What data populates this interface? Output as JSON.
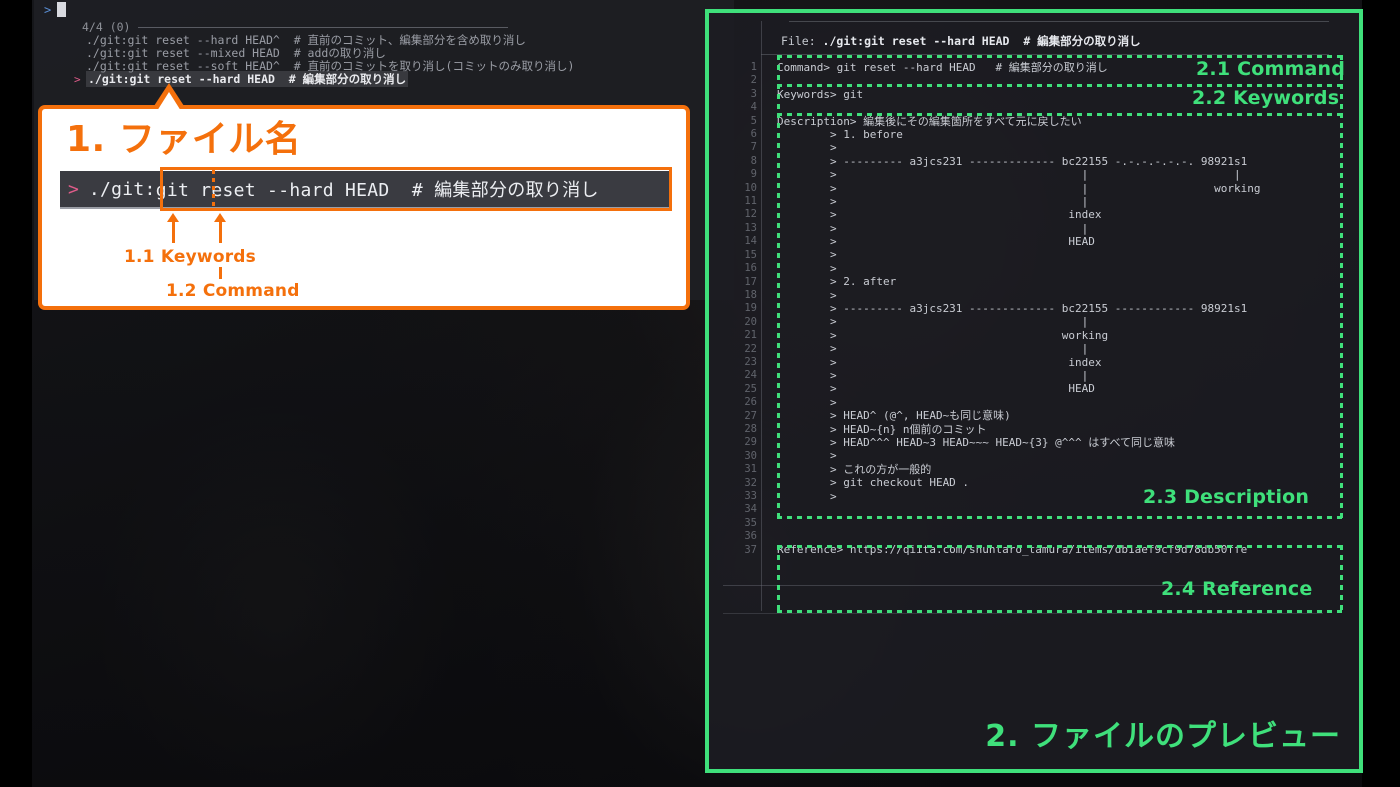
{
  "terminal": {
    "prompt_symbol": ">",
    "counter": "4/4 (0)",
    "items": [
      {
        "marker": "",
        "text": "./git:git reset --hard HEAD^  # 直前のコミット、編集部分を含め取り消し",
        "selected": false
      },
      {
        "marker": "",
        "text": "./git:git reset --mixed HEAD  # addの取り消し",
        "selected": false
      },
      {
        "marker": "",
        "text": "./git:git reset --soft HEAD^  # 直前のコミットを取り消し(コミットのみ取り消し)",
        "selected": false
      },
      {
        "marker": ">",
        "text": "./git:git reset --hard HEAD  # 編集部分の取り消し",
        "selected": true
      }
    ]
  },
  "callout1": {
    "title": "1. ファイル名",
    "prompt": ">",
    "path_prefix": "./",
    "keywords": "git",
    "separator": ":",
    "command": "git reset --hard HEAD  # 編集部分の取り消し",
    "label_keywords": "1.1 Keywords",
    "label_command": "1.2 Command",
    "accent_color": "#F4700C"
  },
  "preview": {
    "title": "2. ファイルのプレビュー",
    "accent_color": "#3FE07B",
    "file_label": "File: ",
    "file_name": "./git:git reset --hard HEAD  # 編集部分の取り消し",
    "line_numbers": [
      1,
      2,
      3,
      4,
      5,
      6,
      7,
      8,
      9,
      10,
      11,
      12,
      13,
      14,
      15,
      16,
      17,
      18,
      19,
      20,
      21,
      22,
      23,
      24,
      25,
      26,
      27,
      28,
      29,
      30,
      31,
      32,
      33,
      34,
      35,
      36,
      37
    ],
    "sections": [
      {
        "id": "command",
        "label": "2.1 Command"
      },
      {
        "id": "keywords",
        "label": "2.2 Keywords"
      },
      {
        "id": "description",
        "label": "2.3 Description"
      },
      {
        "id": "reference",
        "label": "2.4 Reference"
      }
    ],
    "lines": [
      "Command> git reset --hard HEAD   # 編集部分の取り消し",
      "",
      "Keywords> git",
      "",
      "Description> 編集後にその編集箇所をすべて元に戻したい",
      "        > 1. before",
      "        >",
      "        > --------- a3jcs231 ------------- bc22155 -.-.-.-.-.-. 98921s1",
      "        >                                     |                      |",
      "        >                                     |                   working",
      "        >                                     |",
      "        >                                   index",
      "        >                                     |",
      "        >                                   HEAD",
      "        >",
      "        >",
      "        > 2. after",
      "        >",
      "        > --------- a3jcs231 ------------- bc22155 ------------ 98921s1",
      "        >                                     |",
      "        >                                  working",
      "        >                                     |",
      "        >                                   index",
      "        >                                     |",
      "        >                                   HEAD",
      "        >",
      "        > HEAD^ (@^, HEAD~も同じ意味)",
      "        > HEAD~{n} n個前のコミット",
      "        > HEAD^^^ HEAD~3 HEAD~~~ HEAD~{3} @^^^ はすべて同じ意味",
      "        >",
      "        > これの方が一般的",
      "        > git checkout HEAD .",
      "        >",
      "",
      "",
      "",
      "Reference> https://qiita.com/shuntaro_tamura/items/db1aef9cf9d78db50ffe"
    ]
  }
}
